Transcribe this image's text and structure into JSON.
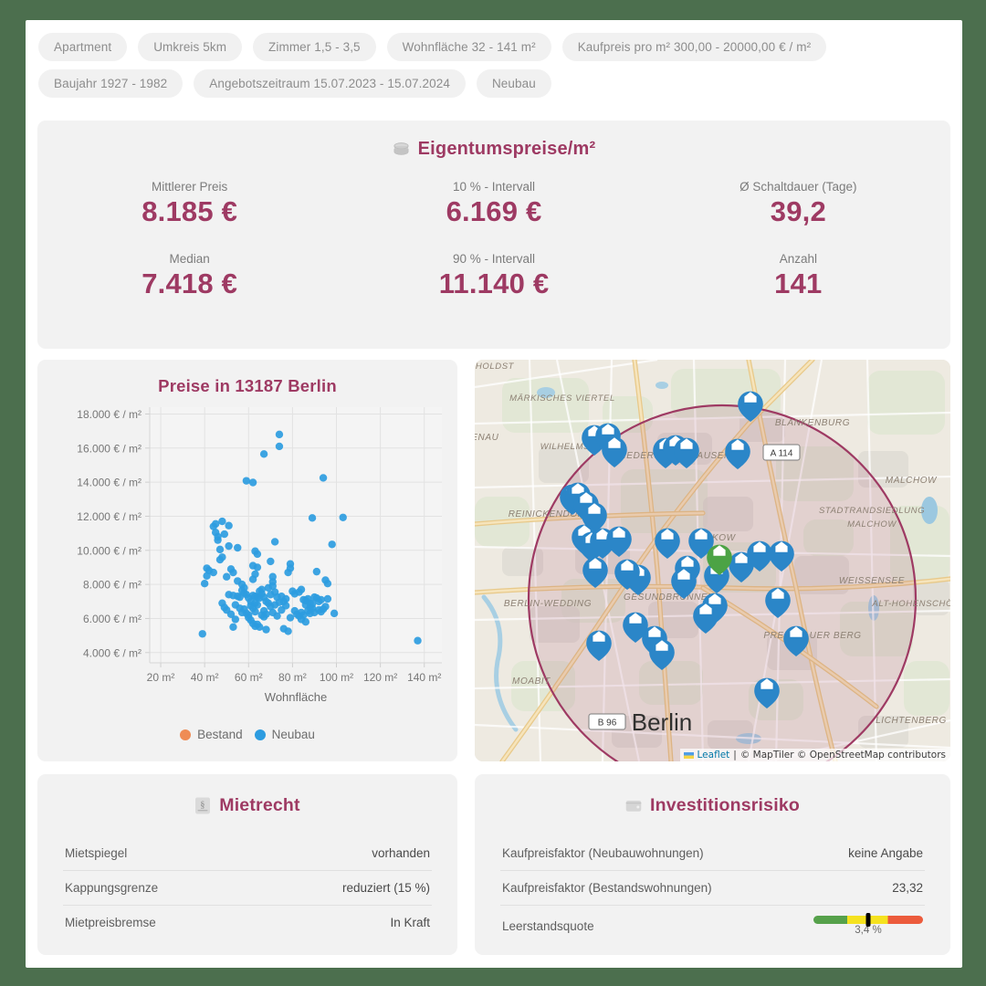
{
  "filters": [
    "Apartment",
    "Umkreis 5km",
    "Zimmer 1,5 - 3,5",
    "Wohnfläche 32 - 141 m²",
    "Kaufpreis pro m² 300,00 - 20000,00 € / m²",
    "Baujahr 1927 - 1982",
    "Angebotszeitraum 15.07.2023 - 15.07.2024",
    "Neubau"
  ],
  "stats": {
    "title": "Eigentumspreise/m²",
    "icon": "coins-icon",
    "items": [
      {
        "label": "Mittlerer Preis",
        "value": "8.185 €"
      },
      {
        "label": "10 % - Intervall",
        "value": "6.169 €"
      },
      {
        "label": "Ø Schaltdauer (Tage)",
        "value": "39,2"
      },
      {
        "label": "Median",
        "value": "7.418 €"
      },
      {
        "label": "90 % - Intervall",
        "value": "11.140 €"
      },
      {
        "label": "Anzahl",
        "value": "141"
      }
    ]
  },
  "chart_data": {
    "type": "scatter",
    "title": "Preise in 13187 Berlin",
    "xlabel": "Wohnfläche",
    "ylabel": "",
    "xlim": [
      15,
      148
    ],
    "ylim": [
      3400,
      18400
    ],
    "grid": true,
    "legend_position": "bottom",
    "xticks": [
      "20 m²",
      "40 m²",
      "60 m²",
      "80 m²",
      "100 m²",
      "120 m²",
      "140 m²"
    ],
    "xtick_values": [
      20,
      40,
      60,
      80,
      100,
      120,
      140
    ],
    "yticks": [
      "4.000 € / m²",
      "6.000 € / m²",
      "8.000 € / m²",
      "10.000 € / m²",
      "12.000 € / m²",
      "14.000 € / m²",
      "16.000 € / m²",
      "18.000 € / m²"
    ],
    "ytick_values": [
      4000,
      6000,
      8000,
      10000,
      12000,
      14000,
      16000,
      18000
    ],
    "series": [
      {
        "name": "Bestand",
        "color": "#ef8c55",
        "points": []
      },
      {
        "name": "Neubau",
        "color": "#2d9ce0",
        "points": [
          [
            74,
            16800
          ],
          [
            74,
            16100
          ],
          [
            67,
            15650
          ],
          [
            59,
            14080
          ],
          [
            62,
            13980
          ],
          [
            94,
            14250
          ],
          [
            89,
            11900
          ],
          [
            103,
            11930
          ],
          [
            45,
            11550
          ],
          [
            48,
            11700
          ],
          [
            51,
            11450
          ],
          [
            44,
            11400
          ],
          [
            49,
            10950
          ],
          [
            46,
            10600
          ],
          [
            51,
            10250
          ],
          [
            55,
            10150
          ],
          [
            47,
            10050
          ],
          [
            72,
            10500
          ],
          [
            98,
            10350
          ],
          [
            48,
            9600
          ],
          [
            63,
            9950
          ],
          [
            64,
            9780
          ],
          [
            41,
            8950
          ],
          [
            42,
            8820
          ],
          [
            44,
            8700
          ],
          [
            41,
            8500
          ],
          [
            52,
            8900
          ],
          [
            53,
            8700
          ],
          [
            50,
            8450
          ],
          [
            55,
            8200
          ],
          [
            62,
            9100
          ],
          [
            64,
            9000
          ],
          [
            63,
            8600
          ],
          [
            62,
            8300
          ],
          [
            70,
            9350
          ],
          [
            71,
            8450
          ],
          [
            71,
            8150
          ],
          [
            71,
            7900
          ],
          [
            79,
            9200
          ],
          [
            79,
            8950
          ],
          [
            78,
            8700
          ],
          [
            91,
            8750
          ],
          [
            95,
            8250
          ],
          [
            96,
            8050
          ],
          [
            40,
            8050
          ],
          [
            57,
            8000
          ],
          [
            58,
            7500
          ],
          [
            51,
            7400
          ],
          [
            53,
            7350
          ],
          [
            55,
            7300
          ],
          [
            56,
            7250
          ],
          [
            59,
            7400
          ],
          [
            60,
            7200
          ],
          [
            61,
            7000
          ],
          [
            61,
            6750
          ],
          [
            62,
            7350
          ],
          [
            63,
            7300
          ],
          [
            64,
            7250
          ],
          [
            65,
            7200
          ],
          [
            63,
            6900
          ],
          [
            64,
            6800
          ],
          [
            62,
            6600
          ],
          [
            63,
            6400
          ],
          [
            66,
            7450
          ],
          [
            67,
            7250
          ],
          [
            68,
            7000
          ],
          [
            69,
            7800
          ],
          [
            70,
            7400
          ],
          [
            72,
            7550
          ],
          [
            73,
            7250
          ],
          [
            75,
            7300
          ],
          [
            76,
            7000
          ],
          [
            77,
            6750
          ],
          [
            80,
            7600
          ],
          [
            81,
            7450
          ],
          [
            83,
            7550
          ],
          [
            84,
            7700
          ],
          [
            85,
            7100
          ],
          [
            86,
            7050
          ],
          [
            86,
            6800
          ],
          [
            87,
            7150
          ],
          [
            88,
            6900
          ],
          [
            88,
            6650
          ],
          [
            89,
            6850
          ],
          [
            89,
            6600
          ],
          [
            90,
            7250
          ],
          [
            91,
            7200
          ],
          [
            92,
            7000
          ],
          [
            93,
            7100
          ],
          [
            87,
            6450
          ],
          [
            88,
            6300
          ],
          [
            90,
            6350
          ],
          [
            96,
            7150
          ],
          [
            99,
            6300
          ],
          [
            48,
            6900
          ],
          [
            49,
            6650
          ],
          [
            50,
            6500
          ],
          [
            54,
            6800
          ],
          [
            56,
            6600
          ],
          [
            57,
            6350
          ],
          [
            58,
            6550
          ],
          [
            59,
            6300
          ],
          [
            60,
            6200
          ],
          [
            66,
            6200
          ],
          [
            67,
            6100
          ],
          [
            71,
            6350
          ],
          [
            73,
            6150
          ],
          [
            79,
            6050
          ],
          [
            83,
            6150
          ],
          [
            84,
            5950
          ],
          [
            86,
            5800
          ],
          [
            62,
            5700
          ],
          [
            63,
            5550
          ],
          [
            64,
            5650
          ],
          [
            65,
            5500
          ],
          [
            68,
            5350
          ],
          [
            76,
            5400
          ],
          [
            78,
            5250
          ],
          [
            53,
            5500
          ],
          [
            39,
            5100
          ],
          [
            137,
            4700
          ],
          [
            45,
            11050
          ],
          [
            46,
            10800
          ],
          [
            47,
            9450
          ],
          [
            65,
            7600
          ],
          [
            66,
            7700
          ],
          [
            69,
            6900
          ],
          [
            70,
            6700
          ],
          [
            74,
            6950
          ],
          [
            75,
            6500
          ],
          [
            81,
            6450
          ],
          [
            82,
            6250
          ],
          [
            92,
            6500
          ],
          [
            93,
            6400
          ],
          [
            94,
            6550
          ],
          [
            95,
            6700
          ],
          [
            85,
            6200
          ],
          [
            84,
            6350
          ],
          [
            61,
            5900
          ],
          [
            60,
            6050
          ],
          [
            57,
            7650
          ],
          [
            58,
            7800
          ],
          [
            52,
            6250
          ],
          [
            54,
            5950
          ],
          [
            67,
            6450
          ],
          [
            68,
            6250
          ],
          [
            72,
            6800
          ],
          [
            77,
            7150
          ]
        ]
      }
    ]
  },
  "map": {
    "city_label": "Berlin",
    "road_label": "B 96",
    "highway_label": "A 114",
    "districts": [
      "MÄRKISCHES VIERTEL",
      "WILHELMSRUH",
      "NIEDERSCHÖNHAUSEN",
      "BLANKENBURG",
      "MALCHOW",
      "REINICKENDORF",
      "STADTRANDSIEDLUNG MALCHOW",
      "PANKOW",
      "WEISSENSEE",
      "BERLIN-WEDDING",
      "GESUNDBRUNNEN",
      "PRENZLAUER BERG",
      "MOABIT",
      "LICHTENBERG",
      "ALT-HOHENSCHÖNHAUSEN",
      "TENAU",
      "HOLDST"
    ],
    "attribution": {
      "leaflet": "Leaflet",
      "separator": "|",
      "credits": "© MapTiler © OpenStreetMap contributors"
    },
    "circle_color": "#9e3a63",
    "marker_color": "#2b86c8",
    "highlight_marker_color": "#4ca345"
  },
  "mietrecht": {
    "title": "Mietrecht",
    "icon": "paragraph-document-icon",
    "rows": [
      {
        "key": "Mietspiegel",
        "value": "vorhanden"
      },
      {
        "key": "Kappungsgrenze",
        "value": "reduziert (15 %)"
      },
      {
        "key": "Mietpreisbremse",
        "value": "In Kraft"
      }
    ]
  },
  "risiko": {
    "title": "Investitionsrisiko",
    "icon": "wallet-icon",
    "rows": [
      {
        "key": "Kaufpreisfaktor (Neubauwohnungen)",
        "value": "keine Angabe"
      },
      {
        "key": "Kaufpreisfaktor (Bestandswohnungen)",
        "value": "23,32"
      }
    ],
    "gauge": {
      "key": "Leerstandsquote",
      "value": "3,4 %",
      "marker_percent": 50,
      "colors": {
        "low": "#56a14b",
        "mid": "#f5e21f",
        "high": "#ec5b3c"
      }
    }
  },
  "theme": {
    "accent": "#9e3a63",
    "page_border": "#4c6f4e",
    "panel_bg": "#f2f2f2",
    "chip_bg": "#f1f1f1"
  }
}
